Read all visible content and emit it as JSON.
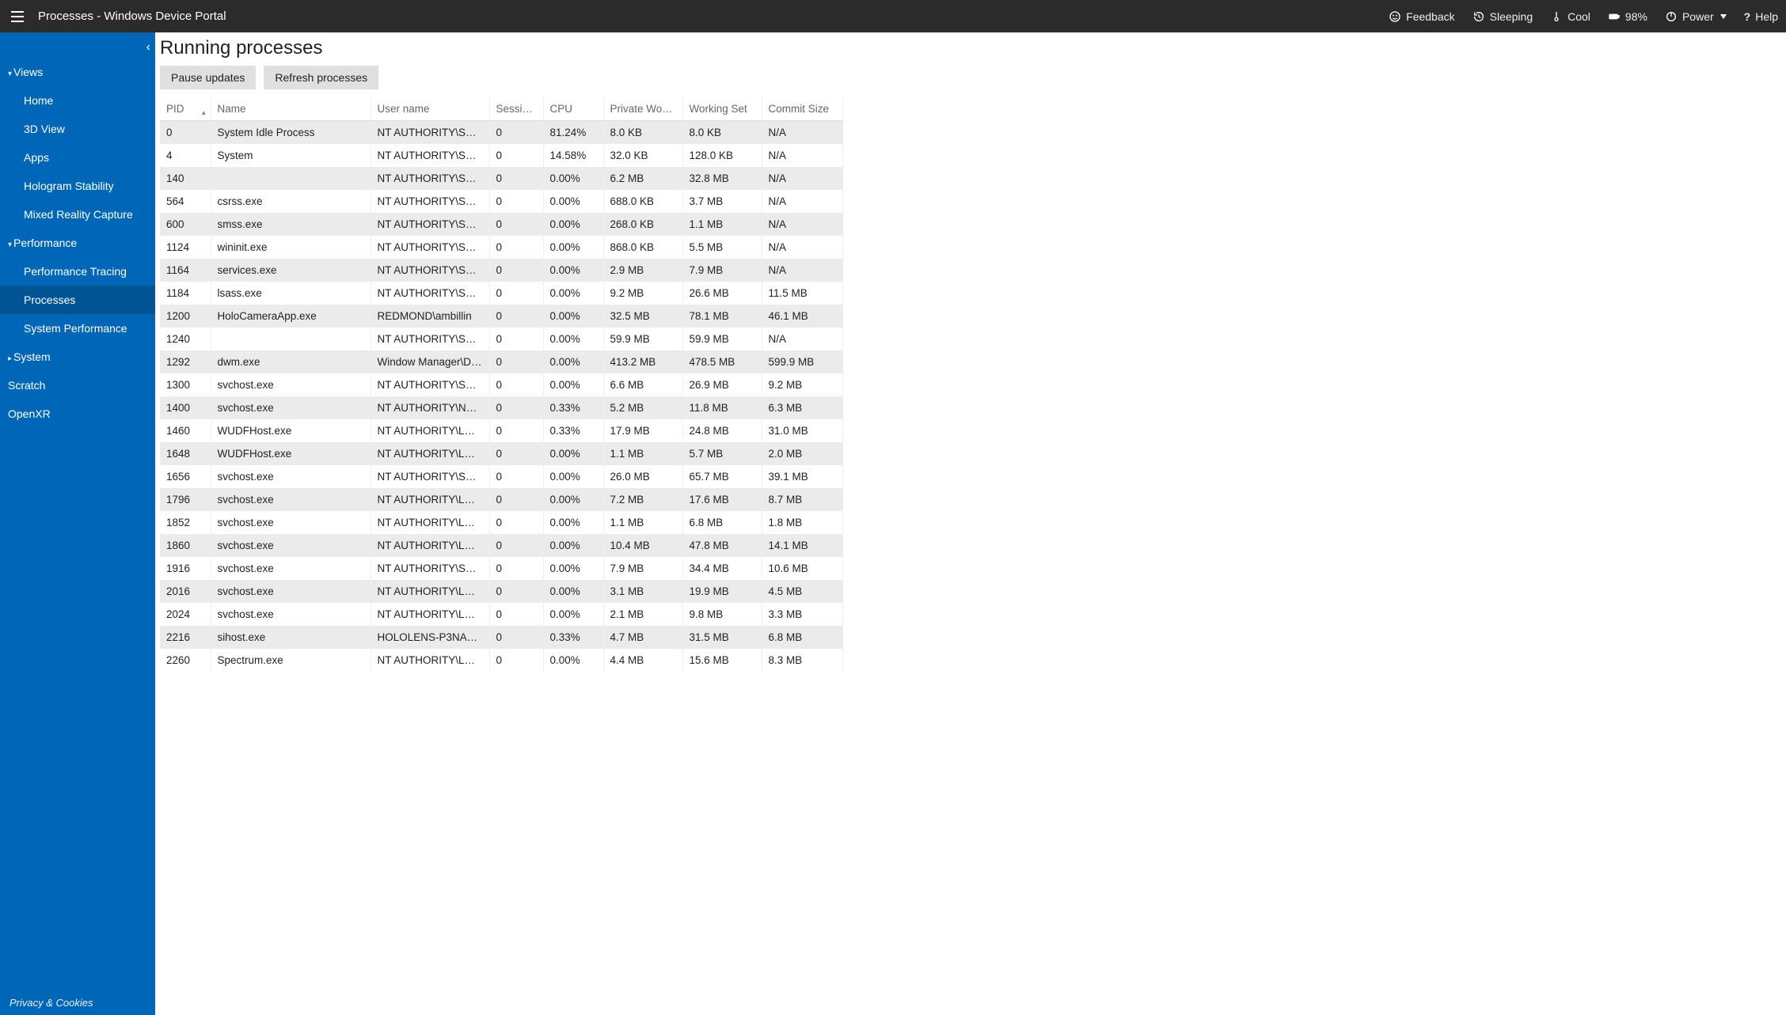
{
  "header": {
    "title": "Processes - Windows Device Portal",
    "status": {
      "feedback": "Feedback",
      "sleeping": "Sleeping",
      "cool": "Cool",
      "battery": "98%",
      "power": "Power",
      "help": "Help"
    }
  },
  "sidebar": {
    "groups": [
      {
        "label": "Views",
        "expanded": true,
        "items": [
          {
            "label": "Home"
          },
          {
            "label": "3D View"
          },
          {
            "label": "Apps"
          },
          {
            "label": "Hologram Stability"
          },
          {
            "label": "Mixed Reality Capture"
          }
        ]
      },
      {
        "label": "Performance",
        "expanded": true,
        "items": [
          {
            "label": "Performance Tracing"
          },
          {
            "label": "Processes",
            "active": true
          },
          {
            "label": "System Performance"
          }
        ]
      },
      {
        "label": "System",
        "expanded": false,
        "items": []
      }
    ],
    "flat_items": [
      {
        "label": "Scratch"
      },
      {
        "label": "OpenXR"
      }
    ],
    "footer": "Privacy & Cookies"
  },
  "page": {
    "title": "Running processes",
    "toolbar": {
      "pause": "Pause updates",
      "refresh": "Refresh processes"
    },
    "columns": [
      "PID",
      "Name",
      "User name",
      "Session Id",
      "CPU",
      "Private Working Set",
      "Working Set",
      "Commit Size"
    ],
    "sort_column": "PID",
    "rows": [
      {
        "pid": "0",
        "name": "System Idle Process",
        "user": "NT AUTHORITY\\SYSTEM",
        "sid": "0",
        "cpu": "81.24%",
        "pws": "8.0 KB",
        "ws": "8.0 KB",
        "cs": "N/A"
      },
      {
        "pid": "4",
        "name": "System",
        "user": "NT AUTHORITY\\SYSTEM",
        "sid": "0",
        "cpu": "14.58%",
        "pws": "32.0 KB",
        "ws": "128.0 KB",
        "cs": "N/A"
      },
      {
        "pid": "140",
        "name": "",
        "user": "NT AUTHORITY\\SYSTEM",
        "sid": "0",
        "cpu": "0.00%",
        "pws": "6.2 MB",
        "ws": "32.8 MB",
        "cs": "N/A"
      },
      {
        "pid": "564",
        "name": "csrss.exe",
        "user": "NT AUTHORITY\\SYSTEM",
        "sid": "0",
        "cpu": "0.00%",
        "pws": "688.0 KB",
        "ws": "3.7 MB",
        "cs": "N/A"
      },
      {
        "pid": "600",
        "name": "smss.exe",
        "user": "NT AUTHORITY\\SYSTEM",
        "sid": "0",
        "cpu": "0.00%",
        "pws": "268.0 KB",
        "ws": "1.1 MB",
        "cs": "N/A"
      },
      {
        "pid": "1124",
        "name": "wininit.exe",
        "user": "NT AUTHORITY\\SYSTEM",
        "sid": "0",
        "cpu": "0.00%",
        "pws": "868.0 KB",
        "ws": "5.5 MB",
        "cs": "N/A"
      },
      {
        "pid": "1164",
        "name": "services.exe",
        "user": "NT AUTHORITY\\SYSTEM",
        "sid": "0",
        "cpu": "0.00%",
        "pws": "2.9 MB",
        "ws": "7.9 MB",
        "cs": "N/A"
      },
      {
        "pid": "1184",
        "name": "lsass.exe",
        "user": "NT AUTHORITY\\SYSTEM",
        "sid": "0",
        "cpu": "0.00%",
        "pws": "9.2 MB",
        "ws": "26.6 MB",
        "cs": "11.5 MB"
      },
      {
        "pid": "1200",
        "name": "HoloCameraApp.exe",
        "user": "REDMOND\\ambillin",
        "sid": "0",
        "cpu": "0.00%",
        "pws": "32.5 MB",
        "ws": "78.1 MB",
        "cs": "46.1 MB"
      },
      {
        "pid": "1240",
        "name": "",
        "user": "NT AUTHORITY\\SYSTEM",
        "sid": "0",
        "cpu": "0.00%",
        "pws": "59.9 MB",
        "ws": "59.9 MB",
        "cs": "N/A"
      },
      {
        "pid": "1292",
        "name": "dwm.exe",
        "user": "Window Manager\\DWM…",
        "sid": "0",
        "cpu": "0.00%",
        "pws": "413.2 MB",
        "ws": "478.5 MB",
        "cs": "599.9 MB"
      },
      {
        "pid": "1300",
        "name": "svchost.exe",
        "user": "NT AUTHORITY\\SYSTEM",
        "sid": "0",
        "cpu": "0.00%",
        "pws": "6.6 MB",
        "ws": "26.9 MB",
        "cs": "9.2 MB"
      },
      {
        "pid": "1400",
        "name": "svchost.exe",
        "user": "NT AUTHORITY\\NETWO…",
        "sid": "0",
        "cpu": "0.33%",
        "pws": "5.2 MB",
        "ws": "11.8 MB",
        "cs": "6.3 MB"
      },
      {
        "pid": "1460",
        "name": "WUDFHost.exe",
        "user": "NT AUTHORITY\\LOCAL …",
        "sid": "0",
        "cpu": "0.33%",
        "pws": "17.9 MB",
        "ws": "24.8 MB",
        "cs": "31.0 MB"
      },
      {
        "pid": "1648",
        "name": "WUDFHost.exe",
        "user": "NT AUTHORITY\\LOCAL …",
        "sid": "0",
        "cpu": "0.00%",
        "pws": "1.1 MB",
        "ws": "5.7 MB",
        "cs": "2.0 MB"
      },
      {
        "pid": "1656",
        "name": "svchost.exe",
        "user": "NT AUTHORITY\\SYSTEM",
        "sid": "0",
        "cpu": "0.00%",
        "pws": "26.0 MB",
        "ws": "65.7 MB",
        "cs": "39.1 MB"
      },
      {
        "pid": "1796",
        "name": "svchost.exe",
        "user": "NT AUTHORITY\\LOCAL …",
        "sid": "0",
        "cpu": "0.00%",
        "pws": "7.2 MB",
        "ws": "17.6 MB",
        "cs": "8.7 MB"
      },
      {
        "pid": "1852",
        "name": "svchost.exe",
        "user": "NT AUTHORITY\\LOCAL …",
        "sid": "0",
        "cpu": "0.00%",
        "pws": "1.1 MB",
        "ws": "6.8 MB",
        "cs": "1.8 MB"
      },
      {
        "pid": "1860",
        "name": "svchost.exe",
        "user": "NT AUTHORITY\\LOCAL …",
        "sid": "0",
        "cpu": "0.00%",
        "pws": "10.4 MB",
        "ws": "47.8 MB",
        "cs": "14.1 MB"
      },
      {
        "pid": "1916",
        "name": "svchost.exe",
        "user": "NT AUTHORITY\\SYSTEM",
        "sid": "0",
        "cpu": "0.00%",
        "pws": "7.9 MB",
        "ws": "34.4 MB",
        "cs": "10.6 MB"
      },
      {
        "pid": "2016",
        "name": "svchost.exe",
        "user": "NT AUTHORITY\\LOCAL …",
        "sid": "0",
        "cpu": "0.00%",
        "pws": "3.1 MB",
        "ws": "19.9 MB",
        "cs": "4.5 MB"
      },
      {
        "pid": "2024",
        "name": "svchost.exe",
        "user": "NT AUTHORITY\\LOCAL …",
        "sid": "0",
        "cpu": "0.00%",
        "pws": "2.1 MB",
        "ws": "9.8 MB",
        "cs": "3.3 MB"
      },
      {
        "pid": "2216",
        "name": "sihost.exe",
        "user": "HOLOLENS-P3NAQ6\\De…",
        "sid": "0",
        "cpu": "0.33%",
        "pws": "4.7 MB",
        "ws": "31.5 MB",
        "cs": "6.8 MB"
      },
      {
        "pid": "2260",
        "name": "Spectrum.exe",
        "user": "NT AUTHORITY\\LOCAL …",
        "sid": "0",
        "cpu": "0.00%",
        "pws": "4.4 MB",
        "ws": "15.6 MB",
        "cs": "8.3 MB"
      }
    ]
  }
}
